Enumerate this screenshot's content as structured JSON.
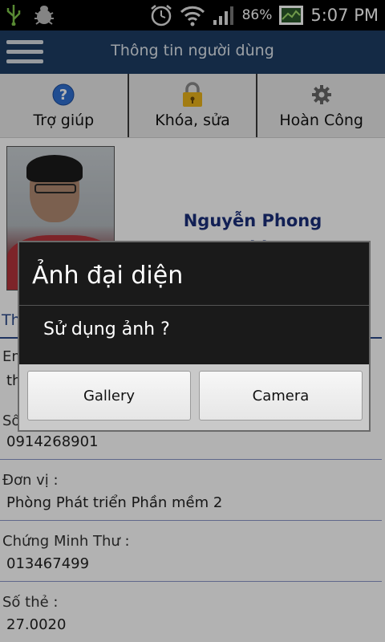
{
  "status_bar": {
    "battery": "86%",
    "time": "5:07 PM",
    "icons": [
      "usb-icon",
      "debug-bug-icon",
      "alarm-clock-icon",
      "wifi-icon",
      "signal-icon",
      "battery-icon",
      "image-notification-icon"
    ]
  },
  "header": {
    "title": "Thông tin người dùng"
  },
  "toolbar": {
    "help_label": "Trợ giúp",
    "lock_label": "Khóa, sửa",
    "done_label": "Hoàn Công"
  },
  "profile": {
    "name_line1": "Nguyễn Phong",
    "name_line2": "Thi"
  },
  "tab": {
    "label": "Thông tin"
  },
  "fields": [
    {
      "label": "Email :",
      "value": "th"
    },
    {
      "label": "Số",
      "value": "0914268901"
    },
    {
      "label": "Đơn vị :",
      "value": "Phòng Phát triển Phần mềm 2"
    },
    {
      "label": "Chứng Minh Thư :",
      "value": "013467499"
    },
    {
      "label": "Số thẻ :",
      "value": "27.0020"
    }
  ],
  "dialog": {
    "title": "Ảnh đại diện",
    "message": "Sử dụng ảnh ?",
    "gallery_label": "Gallery",
    "camera_label": "Camera"
  }
}
